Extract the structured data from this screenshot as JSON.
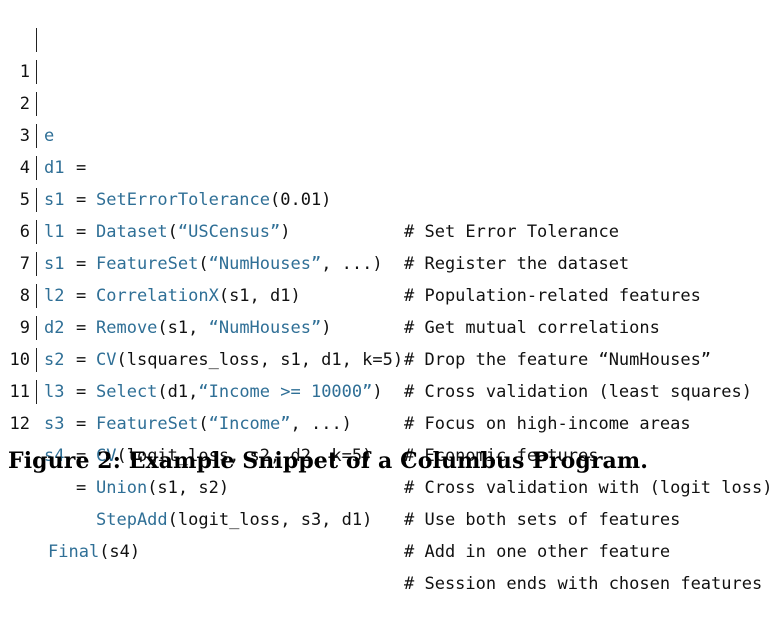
{
  "code": {
    "lines": [
      {
        "num": "1",
        "lhs": "e",
        "eq": "=",
        "rhs": "SetErrorTolerance(0.01)",
        "comment": "# Set Error Tolerance"
      },
      {
        "num": "2",
        "lhs": "d1",
        "eq": "=",
        "rhs": "Dataset(“USCensus”)",
        "comment": "# Register the dataset"
      },
      {
        "num": "3",
        "lhs": "s1",
        "eq": "=",
        "rhs": "FeatureSet(“NumHouses”, ...)",
        "comment": "# Population-related features"
      },
      {
        "num": "4",
        "lhs": "l1",
        "eq": "=",
        "rhs": "CorrelationX(s1, d1)",
        "comment": "# Get mutual correlations"
      },
      {
        "num": "5",
        "lhs": "s1",
        "eq": "=",
        "rhs": "Remove(s1, “NumHouses”)",
        "comment": "# Drop the feature “NumHouses”"
      },
      {
        "num": "6",
        "lhs": "l2",
        "eq": "=",
        "rhs": "CV(lsquares_loss, s1, d1, k=5)",
        "comment": "# Cross validation (least squares)"
      },
      {
        "num": "7",
        "lhs": "d2",
        "eq": "=",
        "rhs": "Select(d1,“Income >= 10000”)",
        "comment": "# Focus on high-income areas"
      },
      {
        "num": "8",
        "lhs": "s2",
        "eq": "=",
        "rhs": "FeatureSet(“Income”, ...)",
        "comment": "# Economic features"
      },
      {
        "num": "9",
        "lhs": "l3",
        "eq": "=",
        "rhs": "CV(logit_loss, s2, d2, k=5)",
        "comment": "# Cross validation with (logit loss)"
      },
      {
        "num": "10",
        "lhs": "s3",
        "eq": "=",
        "rhs": "Union(s1, s2)",
        "comment": "# Use both sets of features"
      },
      {
        "num": "11",
        "lhs": "s4",
        "eq": "=",
        "rhs": "StepAdd(logit_loss, s3, d1)",
        "comment": "# Add in one other feature"
      },
      {
        "num": "12",
        "lhs": "",
        "eq": "",
        "rhs": "Final(s4)",
        "comment": "# Session ends with chosen features"
      }
    ]
  },
  "caption": "Figure 2: Example Snippet of a Columbus Program."
}
